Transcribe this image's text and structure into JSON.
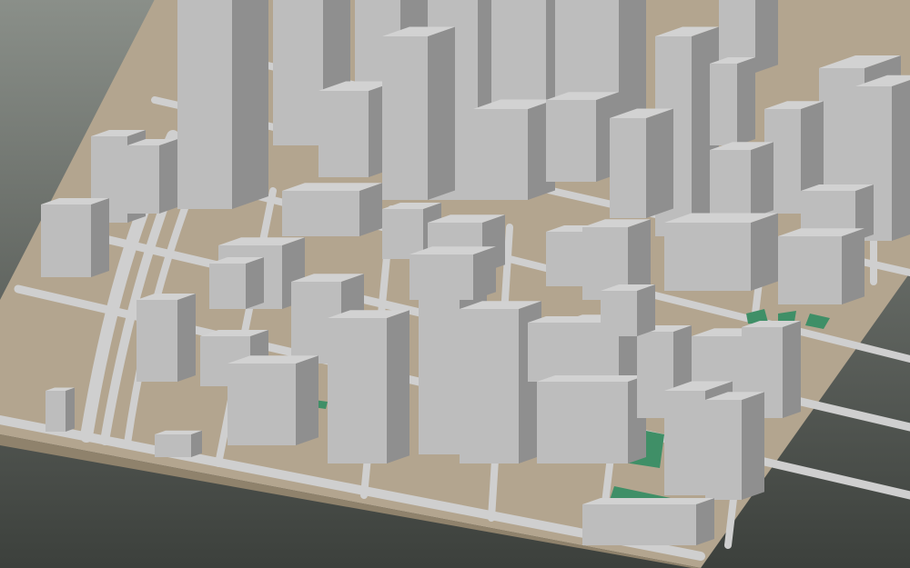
{
  "scene": {
    "colors": {
      "background_top": "#8a8f89",
      "background_bottom": "#3c403c",
      "ground": "#b3a58f",
      "ground_edge": "#8f826c",
      "road": "#cfcfcf",
      "building_top": "#d2d2d2",
      "building_left": "#bdbdbd",
      "building_right": "#8f8f8f",
      "park": "#3f8f67"
    }
  }
}
